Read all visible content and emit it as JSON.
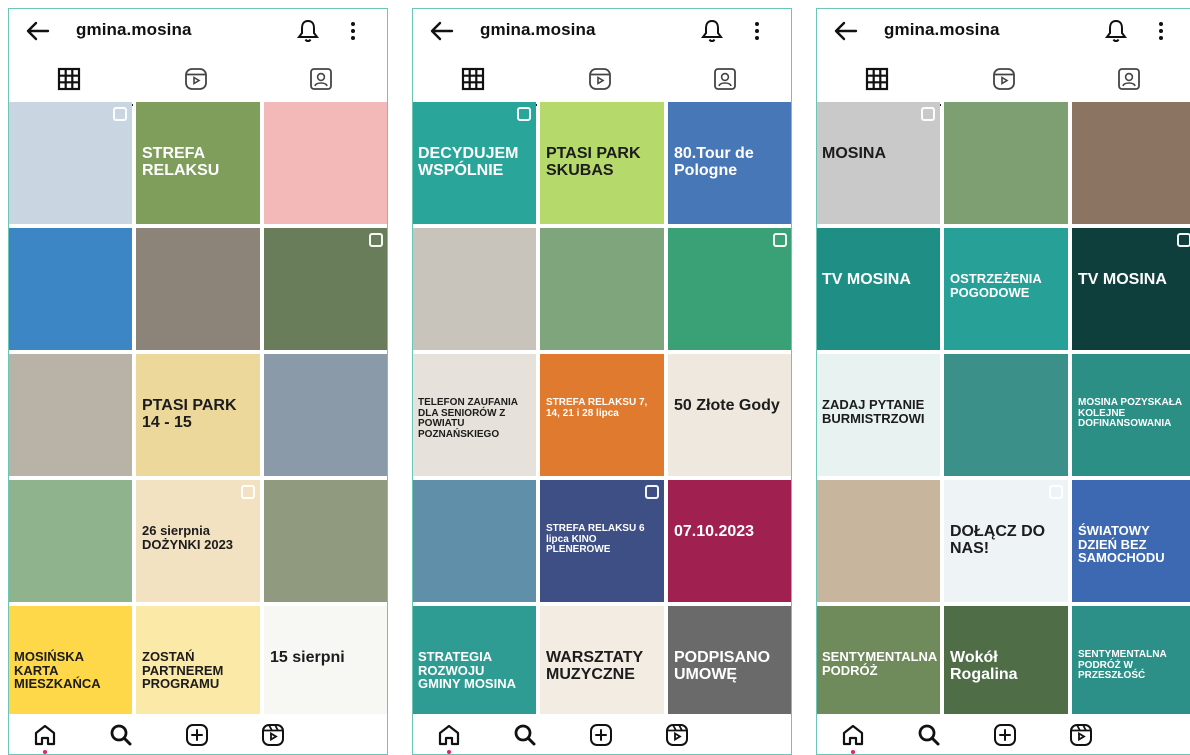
{
  "screens": [
    {
      "username": "gmina.mosina",
      "tiles": [
        {
          "text": "",
          "bg": "#c9d6e2"
        },
        {
          "text": "STREFA RELAKSU",
          "bg": "#7f9e5c"
        },
        {
          "text": "",
          "bg": "#f3b9b9"
        },
        {
          "text": "",
          "bg": "#3d86c6"
        },
        {
          "text": "",
          "bg": "#8d8479"
        },
        {
          "text": "",
          "bg": "#6a7d5a"
        },
        {
          "text": "",
          "bg": "#b9b2a6"
        },
        {
          "text": "PTASI PARK 14 - 15",
          "bg": "#ecd89a"
        },
        {
          "text": "",
          "bg": "#8b9aa8"
        },
        {
          "text": "",
          "bg": "#8fb38c"
        },
        {
          "text": "26 sierpnia DOŻYNKI 2023",
          "bg": "#f2e2c2"
        },
        {
          "text": "",
          "bg": "#8f9a7f"
        },
        {
          "text": "MOSIŃSKA KARTA MIESZKAŃCA",
          "bg": "#ffd84a"
        },
        {
          "text": "ZOSTAŃ PARTNEREM PROGRAMU",
          "bg": "#fbe9a8"
        },
        {
          "text": "15 sierpni",
          "bg": "#f7f7f4"
        }
      ]
    },
    {
      "username": "gmina.mosina",
      "tiles": [
        {
          "text": "DECYDUJEM WSPÓLNIE",
          "bg": "#2aa59a"
        },
        {
          "text": "PTASI PARK SKUBAS",
          "bg": "#b5d96a"
        },
        {
          "text": "80.Tour de Pologne",
          "bg": "#4877b8"
        },
        {
          "text": "",
          "bg": "#c8c3bb"
        },
        {
          "text": "",
          "bg": "#7ea57b"
        },
        {
          "text": "",
          "bg": "#3aa177"
        },
        {
          "text": "TELEFON ZAUFANIA DLA SENIORÓW Z POWIATU POZNAŃSKIEGO",
          "bg": "#e6e1da"
        },
        {
          "text": "STREFA RELAKSU 7, 14, 21 i 28 lipca",
          "bg": "#e07a2e"
        },
        {
          "text": "50 Złote Gody",
          "bg": "#eee8de"
        },
        {
          "text": "",
          "bg": "#5f8fa9"
        },
        {
          "text": "STREFA RELAKSU 6 lipca KINO PLENEROWE",
          "bg": "#3e4f86"
        },
        {
          "text": "07.10.2023",
          "bg": "#a0204f"
        },
        {
          "text": "STRATEGIA ROZWOJU GMINY MOSINA",
          "bg": "#2e9c93"
        },
        {
          "text": "WARSZTATY MUZYCZNE",
          "bg": "#f2ece2"
        },
        {
          "text": "PODPISANO UMOWĘ",
          "bg": "#6a6a6a"
        }
      ]
    },
    {
      "username": "gmina.mosina",
      "tiles": [
        {
          "text": "MOSINA",
          "bg": "#c9c9c9"
        },
        {
          "text": "",
          "bg": "#7d9f71"
        },
        {
          "text": "",
          "bg": "#8c7463"
        },
        {
          "text": "TV MOSINA",
          "bg": "#1f8f86"
        },
        {
          "text": "OSTRZEŻENIA POGODOWE",
          "bg": "#27a097"
        },
        {
          "text": "TV MOSINA",
          "bg": "#0f3f3c"
        },
        {
          "text": "ZADAJ PYTANIE BURMISTRZOWI",
          "bg": "#e8f3f1"
        },
        {
          "text": "",
          "bg": "#3b918a"
        },
        {
          "text": "MOSINA POZYSKAŁA KOLEJNE DOFINANSOWANIA",
          "bg": "#2c8f86"
        },
        {
          "text": "",
          "bg": "#c8b59d"
        },
        {
          "text": "DOŁĄCZ DO NAS!",
          "bg": "#eef3f6"
        },
        {
          "text": "ŚWIATOWY DZIEŃ BEZ SAMOCHODU",
          "bg": "#3d69b2"
        },
        {
          "text": "SENTYMENTALNA PODRÓŻ",
          "bg": "#6f8a5b"
        },
        {
          "text": "Wokół Rogalina",
          "bg": "#4f6d46"
        },
        {
          "text": "SENTYMENTALNA PODRÓŻ W PRZESZŁOŚĆ",
          "bg": "#2c9088"
        }
      ]
    }
  ]
}
